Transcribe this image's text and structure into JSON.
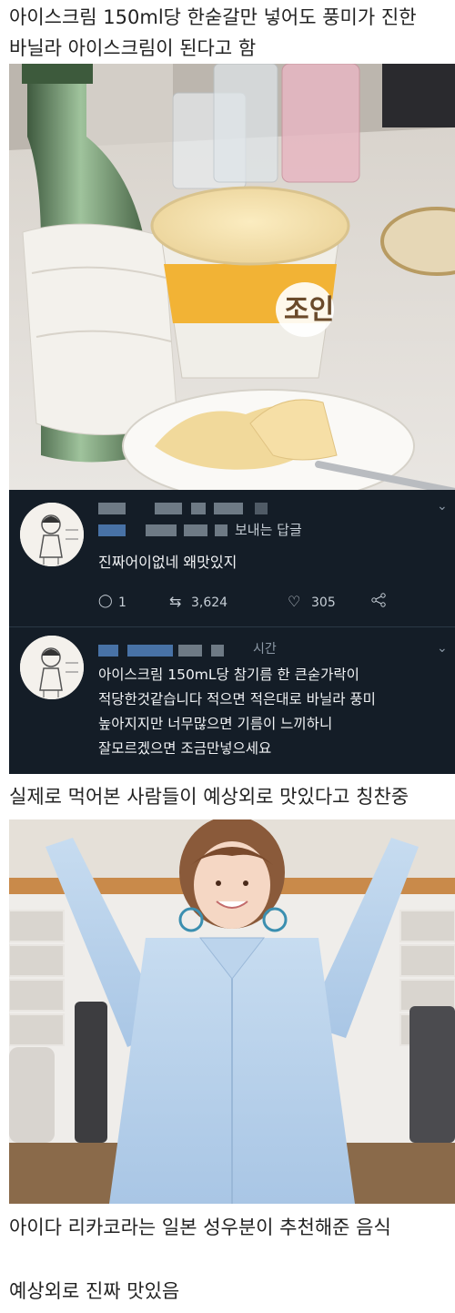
{
  "post": {
    "caption_1_line_1": "아이스크림 150ml당 한숟갈만 넣어도 풍미가 진한",
    "caption_1_line_2": "바닐라 아이스크림이 된다고 함",
    "caption_2": "실제로 먹어본 사람들이 예상외로 맛있다고 칭찬중",
    "caption_3": "아이다 리카코라는 일본 성우분이 추천해준 음식",
    "caption_4": "예상외로 진짜 맛있음"
  },
  "photo_ice": {
    "cup_label": "조인"
  },
  "tweets": [
    {
      "subheader": "보내는 답글",
      "text": "진짜어이없네 왜맛있지",
      "reply_count": "1",
      "retweet_count": "3,624",
      "like_count": "305"
    },
    {
      "subheader": "시간",
      "text_line_1": "아이스크림 150mL당 참기름 한 큰숟가락이",
      "text_line_2": "적당한것같습니다 적으면 적은대로 바닐라 풍미",
      "text_line_3": "높아지지만 너무많으면 기름이 느끼하니",
      "text_line_4": "잘모르겠으면 조금만넣으세요"
    }
  ],
  "colors": {
    "tweet_bg": "#141d27",
    "accent_blue": "#5a8fd1"
  }
}
